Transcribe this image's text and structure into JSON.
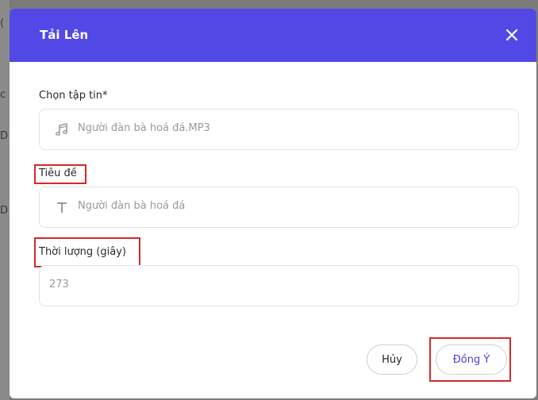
{
  "background": {
    "glyphs": [
      "(",
      "c",
      "D",
      "D"
    ]
  },
  "dialog": {
    "title": "Tải Lên",
    "close_icon": "close-icon",
    "header_color": "#5248e6",
    "highlight_color": "#d62828"
  },
  "fields": {
    "file": {
      "label": "Chọn tập tin*",
      "value": "Người đàn bà hoá đá.MP3",
      "icon": "music-note-icon"
    },
    "title": {
      "label": "Tiêu đề",
      "value": "Người đàn bà hoá đá",
      "icon": "text-t-icon"
    },
    "duration": {
      "label": "Thời lượng (giây)",
      "value": "273"
    }
  },
  "actions": {
    "cancel_label": "Hủy",
    "ok_label": "Đồng Ý"
  }
}
